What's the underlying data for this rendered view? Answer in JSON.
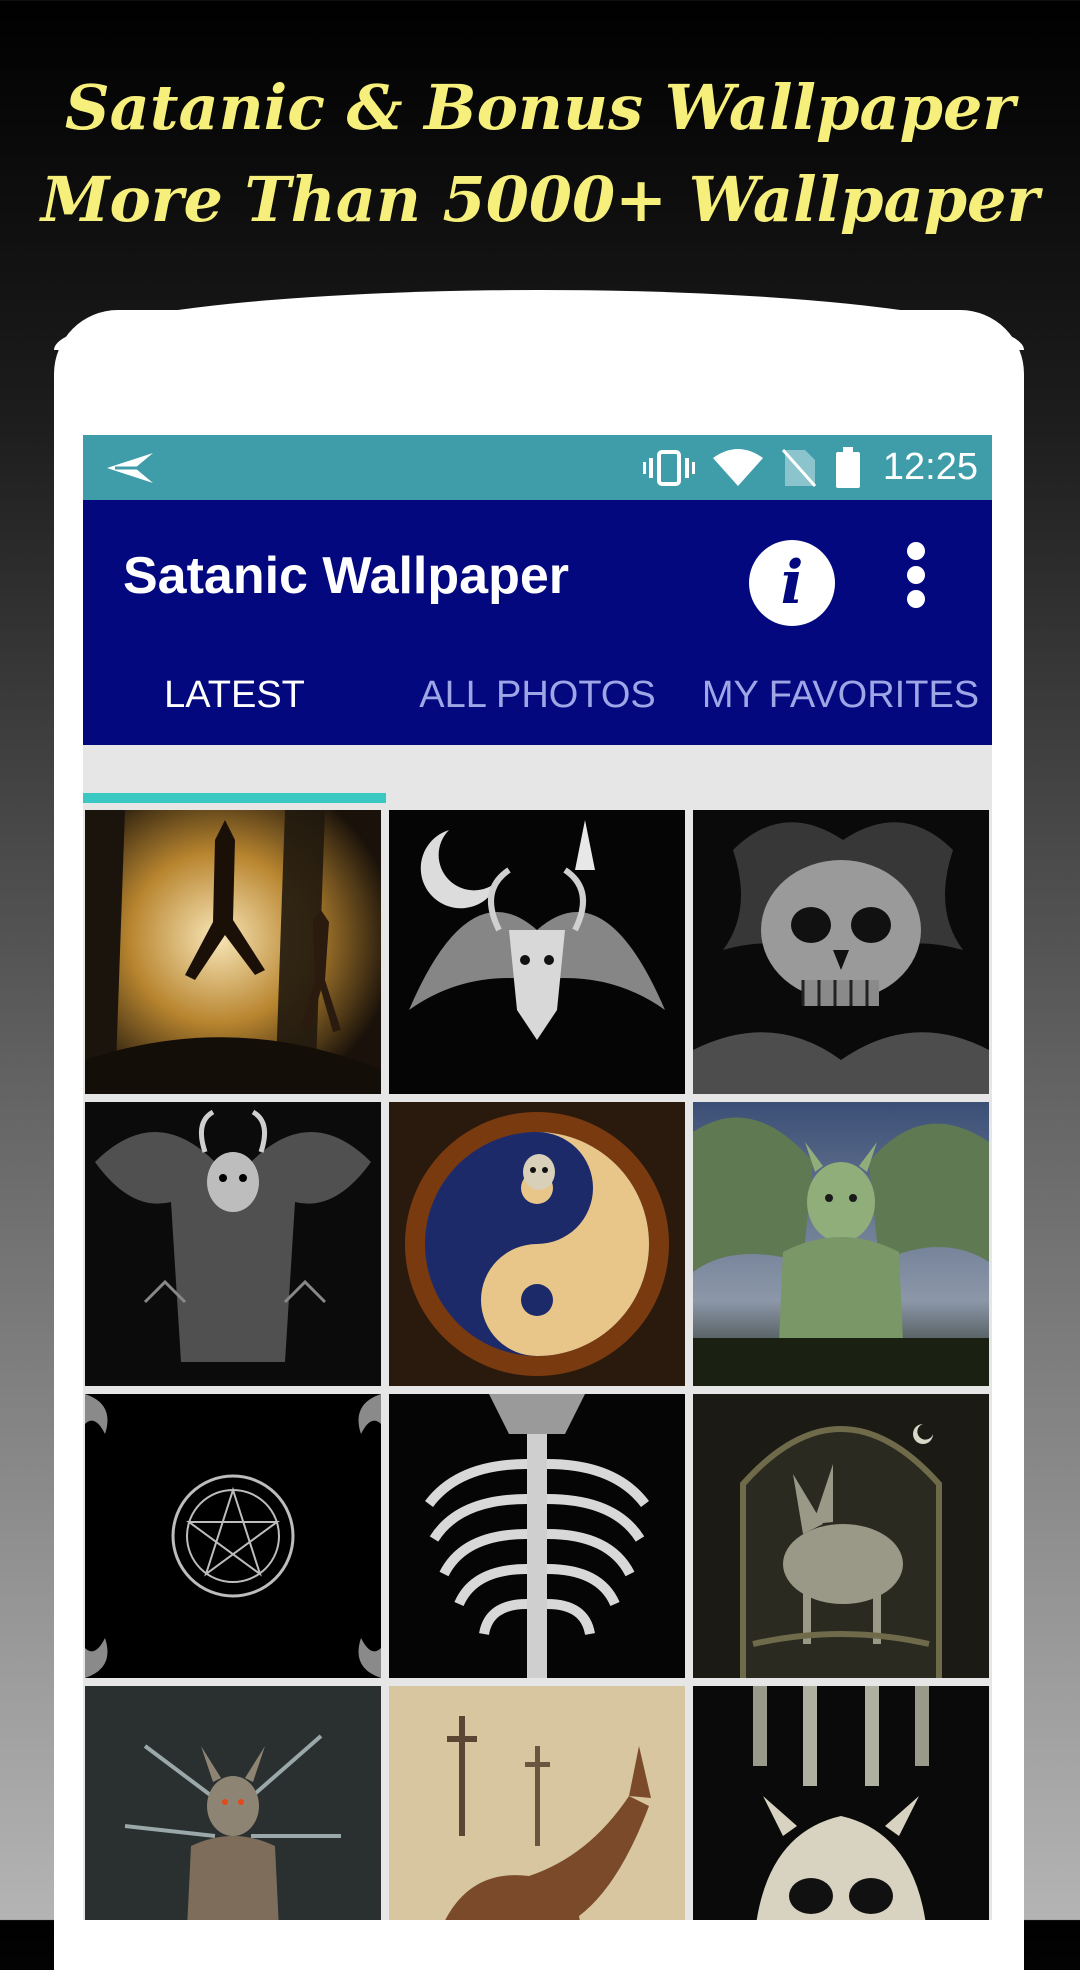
{
  "promo": {
    "line1": "Satanic & Bonus Wallpaper",
    "line2": "More Than 5000+ Wallpaper",
    "color": "#f6ef7c"
  },
  "status_bar": {
    "time": "12:25",
    "color": "#3f9daa",
    "icons": [
      "send-icon",
      "vibrate-icon",
      "wifi-icon",
      "no-sim-icon",
      "battery-icon"
    ]
  },
  "app_bar": {
    "title": "Satanic Wallpaper",
    "info_label": "i",
    "color": "#03087f",
    "icons": [
      "info-icon",
      "more-vert-icon"
    ]
  },
  "tabs": [
    {
      "label": "LATEST",
      "active": true
    },
    {
      "label": "ALL PHOTOS",
      "active": false
    },
    {
      "label": "MY FAVORITES",
      "active": false
    }
  ],
  "accent_color": "#39c9c2",
  "wallpapers": [
    {
      "subject": "horned figure in misty forest"
    },
    {
      "subject": "winged goat idol with crescent moon"
    },
    {
      "subject": "grey skull with flames"
    },
    {
      "subject": "horned demon with bat wings"
    },
    {
      "subject": "grim reaper yin-yang"
    },
    {
      "subject": "green gargoyle statue"
    },
    {
      "subject": "pentagram seal"
    },
    {
      "subject": "ribcage skeleton"
    },
    {
      "subject": "goat in gothic frame"
    },
    {
      "subject": "spiked armored demon"
    },
    {
      "subject": "beast before crosses"
    },
    {
      "subject": "horned figure with candles"
    }
  ]
}
